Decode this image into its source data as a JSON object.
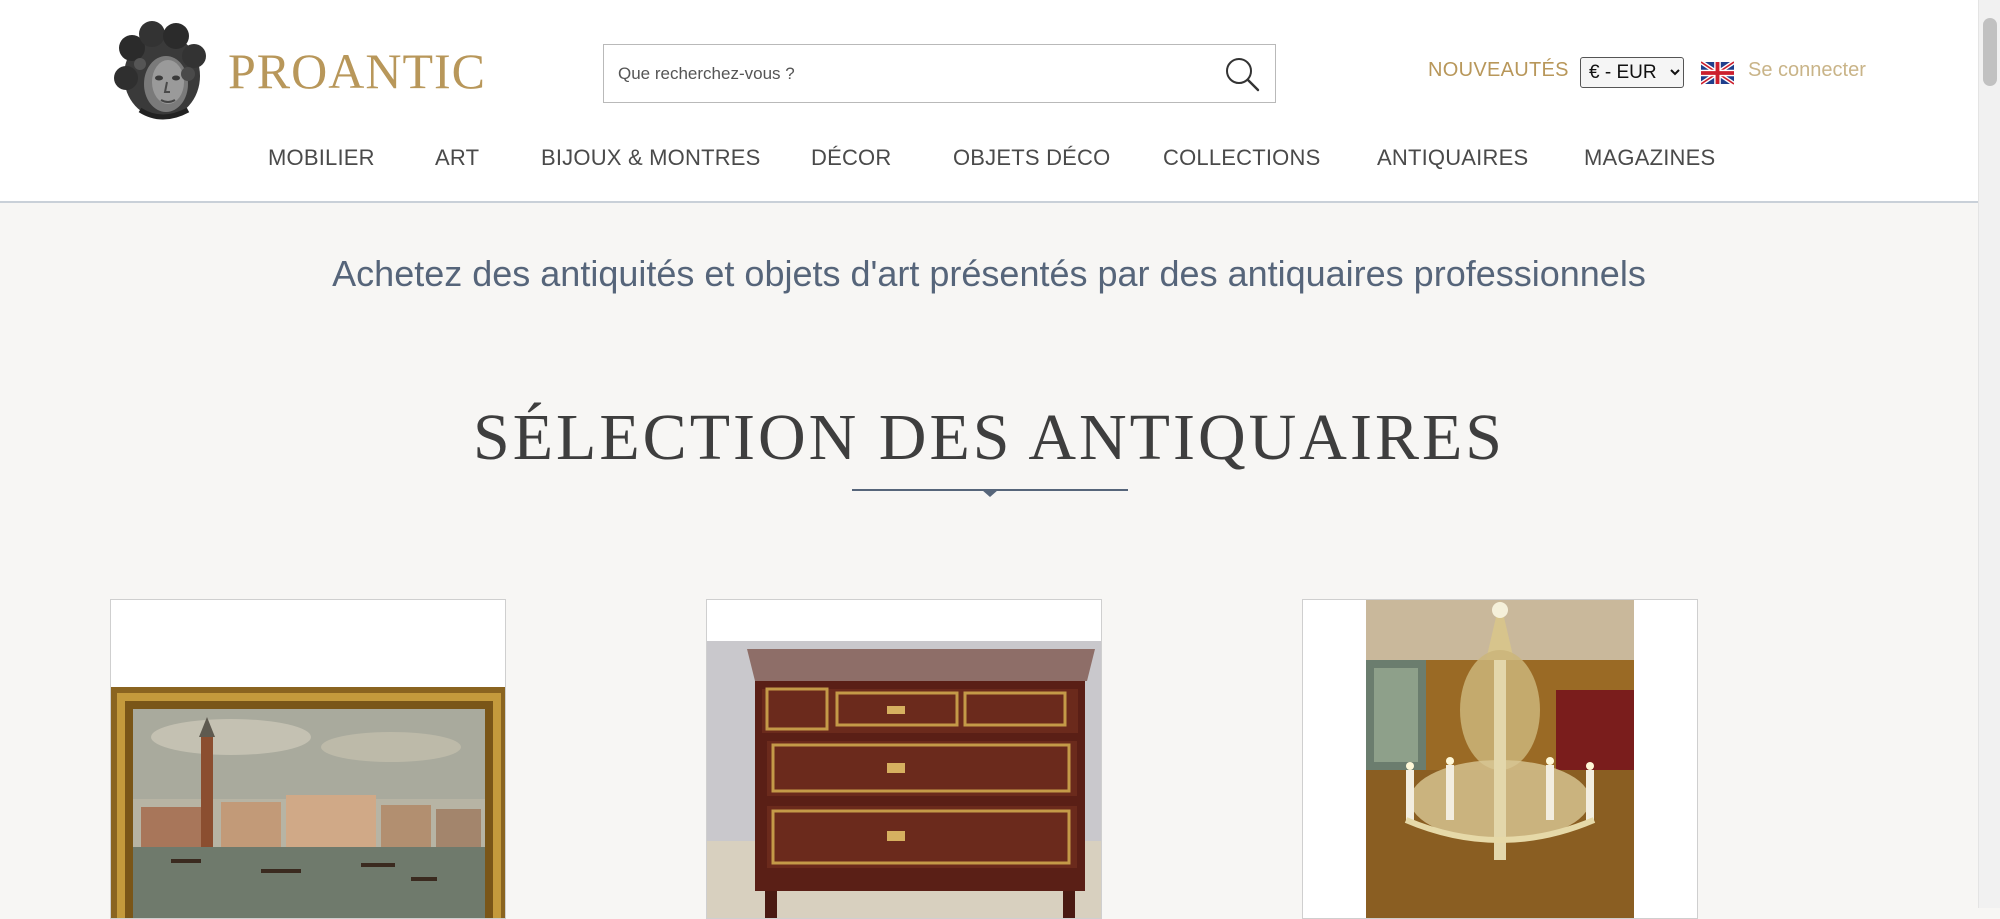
{
  "header": {
    "logo_text": "PROANTIC",
    "search": {
      "placeholder": "Que recherchez-vous ?"
    },
    "nouveautes_label": "NOUVEAUTÉS",
    "currency": {
      "selected": "€ - EUR"
    },
    "login_label": "Se connecter",
    "nav": [
      {
        "label": "MOBILIER"
      },
      {
        "label": "ART"
      },
      {
        "label": "BIJOUX & MONTRES"
      },
      {
        "label": "DÉCOR"
      },
      {
        "label": "OBJETS DÉCO"
      },
      {
        "label": "COLLECTIONS"
      },
      {
        "label": "ANTIQUAIRES"
      },
      {
        "label": "MAGAZINES"
      }
    ]
  },
  "main": {
    "tagline": "Achetez des antiquités et objets d'art présentés par des antiquaires professionnels",
    "section_title": "SÉLECTION DES ANTIQUAIRES",
    "cards": [
      {
        "image": "venice-painting-image"
      },
      {
        "image": "commode-chest-image"
      },
      {
        "image": "crystal-chandelier-image"
      }
    ]
  },
  "colors": {
    "brand_gold": "#b8975a",
    "tagline_blue": "#56657a",
    "page_bg": "#f7f6f4"
  }
}
